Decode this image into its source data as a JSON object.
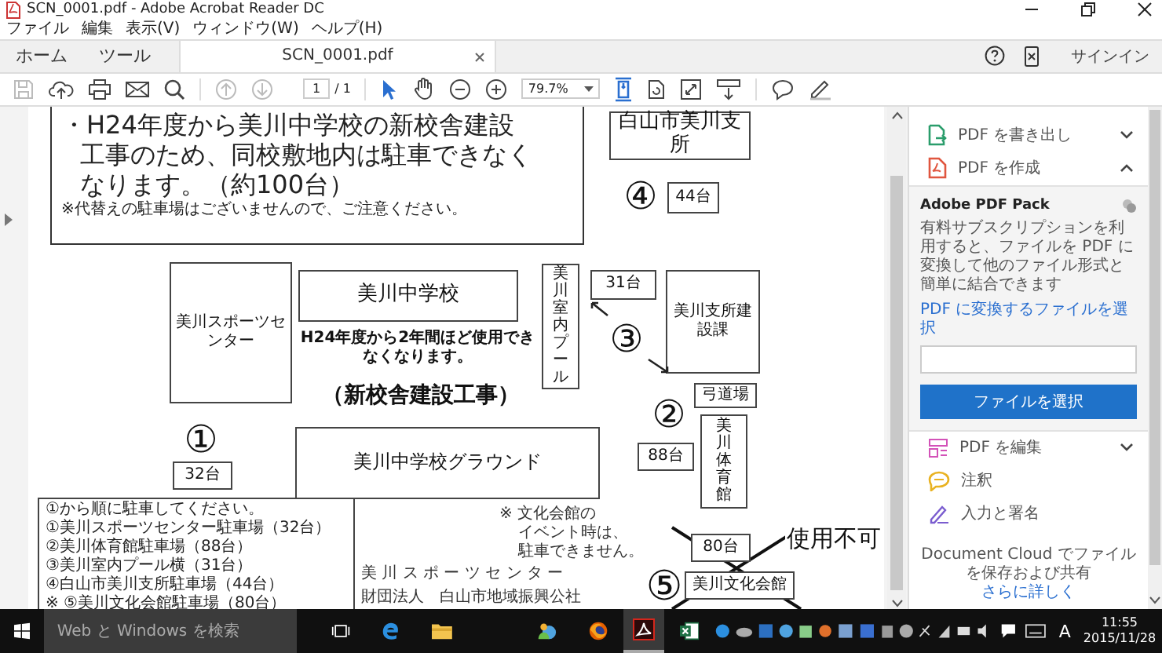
{
  "window": {
    "title": "SCN_0001.pdf - Adobe Acrobat Reader DC"
  },
  "menu": [
    "ファイル",
    "編集",
    "表示(V)",
    "ウィンドウ(W)",
    "ヘルプ(H)"
  ],
  "tabs": [
    {
      "label": "ホーム",
      "selected": false
    },
    {
      "label": "ツール",
      "selected": false
    },
    {
      "label": "SCN_0001.pdf",
      "selected": true
    }
  ],
  "sign_in": "サインイン",
  "toolbar": {
    "page": "1",
    "page_total": "/ 1",
    "zoom": "79.7%"
  },
  "document": {
    "notice": {
      "lines": [
        "・H24年度から美川中学校の新校舎建設",
        "工事のため、同校敷地内は駐車できなく",
        "なります。（約100台）"
      ],
      "note": "※代替えの駐車場はございませんので、ご注意ください。"
    },
    "map_labels": [
      {
        "text": "白山市美川支所",
        "kind": "box"
      },
      {
        "text": "④",
        "kind": "circle"
      },
      {
        "text": "44台",
        "kind": "box"
      },
      {
        "text": "美川スポーツセンター",
        "kind": "box"
      },
      {
        "text": "美川中学校",
        "kind": "box"
      },
      {
        "text": "美川室内プール",
        "kind": "vbox"
      },
      {
        "text": "31台",
        "kind": "box"
      },
      {
        "text": "③",
        "kind": "circle"
      },
      {
        "text": "美川支所建設課",
        "kind": "box"
      },
      {
        "text": "H24年度から2年間ほど使用できなくなります。",
        "kind": "plain"
      },
      {
        "text": "（新校舎建設工事）",
        "kind": "plain"
      },
      {
        "text": "①",
        "kind": "circle"
      },
      {
        "text": "32台",
        "kind": "box"
      },
      {
        "text": "美川中学校グラウンド",
        "kind": "box"
      },
      {
        "text": "弓道場",
        "kind": "box"
      },
      {
        "text": "②",
        "kind": "circle"
      },
      {
        "text": "88台",
        "kind": "box"
      },
      {
        "text": "美川体育館",
        "kind": "vbox"
      },
      {
        "text": "⑤",
        "kind": "circle"
      },
      {
        "text": "80台",
        "kind": "box"
      },
      {
        "text": "美川文化会館",
        "kind": "box"
      },
      {
        "text": "使用不可",
        "kind": "hand"
      }
    ],
    "legend": {
      "intro": "①から順に駐車してください。",
      "items": [
        "①美川スポーツセンター駐車場（32台）",
        "②美川体育館駐車場（88台）",
        "③美川室内プール横（31台）",
        "④白山市美川支所駐車場（44台）",
        "※ ⑤美川文化会館駐車場（80台）"
      ]
    },
    "organizer": [
      "美 川 ス ポ ー ツ セ ン タ ー",
      "財団法人　白山市地域振興公社"
    ],
    "event_note": [
      "※ 文化会館の",
      "イベント時は、",
      "駐車できません。"
    ]
  },
  "panel": {
    "tools": [
      {
        "label": "PDF を書き出し",
        "expanded": false
      },
      {
        "label": "PDF を作成",
        "expanded": true
      },
      {
        "label": "PDF を編集",
        "expanded": false
      },
      {
        "label": "注釈"
      },
      {
        "label": "入力と署名"
      }
    ],
    "pack": {
      "title": "Adobe PDF Pack",
      "description": "有料サブスクリプションを利用すると、ファイルを PDF に変換して他のファイル形式と簡単に結合できます",
      "link": "PDF に変換するファイルを選択",
      "button": "ファイルを選択"
    },
    "footer": {
      "text": "Document Cloud でファイルを保存および共有",
      "link": "さらに詳しく"
    }
  },
  "taskbar": {
    "search_placeholder": "Web と Windows を検索",
    "ime": "A",
    "time": "11:55",
    "date": "2015/11/28"
  }
}
